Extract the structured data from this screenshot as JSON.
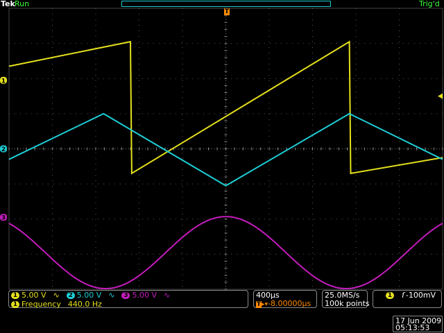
{
  "colors": {
    "ch1": "#e5e01c",
    "ch2": "#1ccfd6",
    "ch3": "#c51cbd",
    "trigger": "#ff8a00",
    "grid": "#5a5a5a"
  },
  "header": {
    "brand": "Tek",
    "run_state": "Run",
    "trigger_status": "Trig'd",
    "trigger_marker": "T"
  },
  "channels": [
    {
      "number": "1",
      "volts_per_div": "5.00 V",
      "coupling_icon": "bandwidth-icon"
    },
    {
      "number": "2",
      "volts_per_div": "5.00 V",
      "coupling_icon": "bandwidth-icon"
    },
    {
      "number": "3",
      "volts_per_div": "5.00 V",
      "coupling_icon": "bandwidth-icon"
    }
  ],
  "measurement": {
    "channel": "1",
    "label": "Frequency",
    "value": "440.0 Hz"
  },
  "timebase": {
    "time_per_div": "400µs",
    "trigger_marker": "T",
    "position": "-8.00000µs"
  },
  "acquisition": {
    "sample_rate": "25.0MS/s",
    "record_length": "100k points"
  },
  "trigger": {
    "channel": "1",
    "slope_icon": "rising-edge-icon",
    "level": "-100mV"
  },
  "datetime": {
    "date": "17 Jun 2009",
    "time": "05:13:53"
  },
  "chart_data": {
    "type": "line",
    "title": "",
    "xlabel": "",
    "ylabel": "",
    "x_divisions": 10,
    "y_divisions": 8,
    "xlim": [
      0,
      10
    ],
    "ylim": [
      -4,
      4
    ],
    "grid": true,
    "series": [
      {
        "channel": "1",
        "shape": "sawtooth",
        "x": [
          0,
          3,
          3,
          10
        ],
        "y": [
          2.35,
          3.05,
          -0.7,
          2.9
        ],
        "x2": [
          10,
          13
        ],
        "y2": [
          -0.7,
          0.1
        ]
      },
      {
        "channel": "2",
        "shape": "triangle",
        "x": [
          0,
          2.3,
          5,
          7.7,
          10
        ],
        "y": [
          -0.45,
          0.95,
          -1.05,
          0.95,
          -0.45
        ]
      },
      {
        "channel": "3",
        "shape": "sine",
        "period_div": 5.45,
        "min_div_x": 2.1,
        "max_y": -1.93,
        "min_y": -3.98,
        "start_y": -2.4
      }
    ]
  }
}
